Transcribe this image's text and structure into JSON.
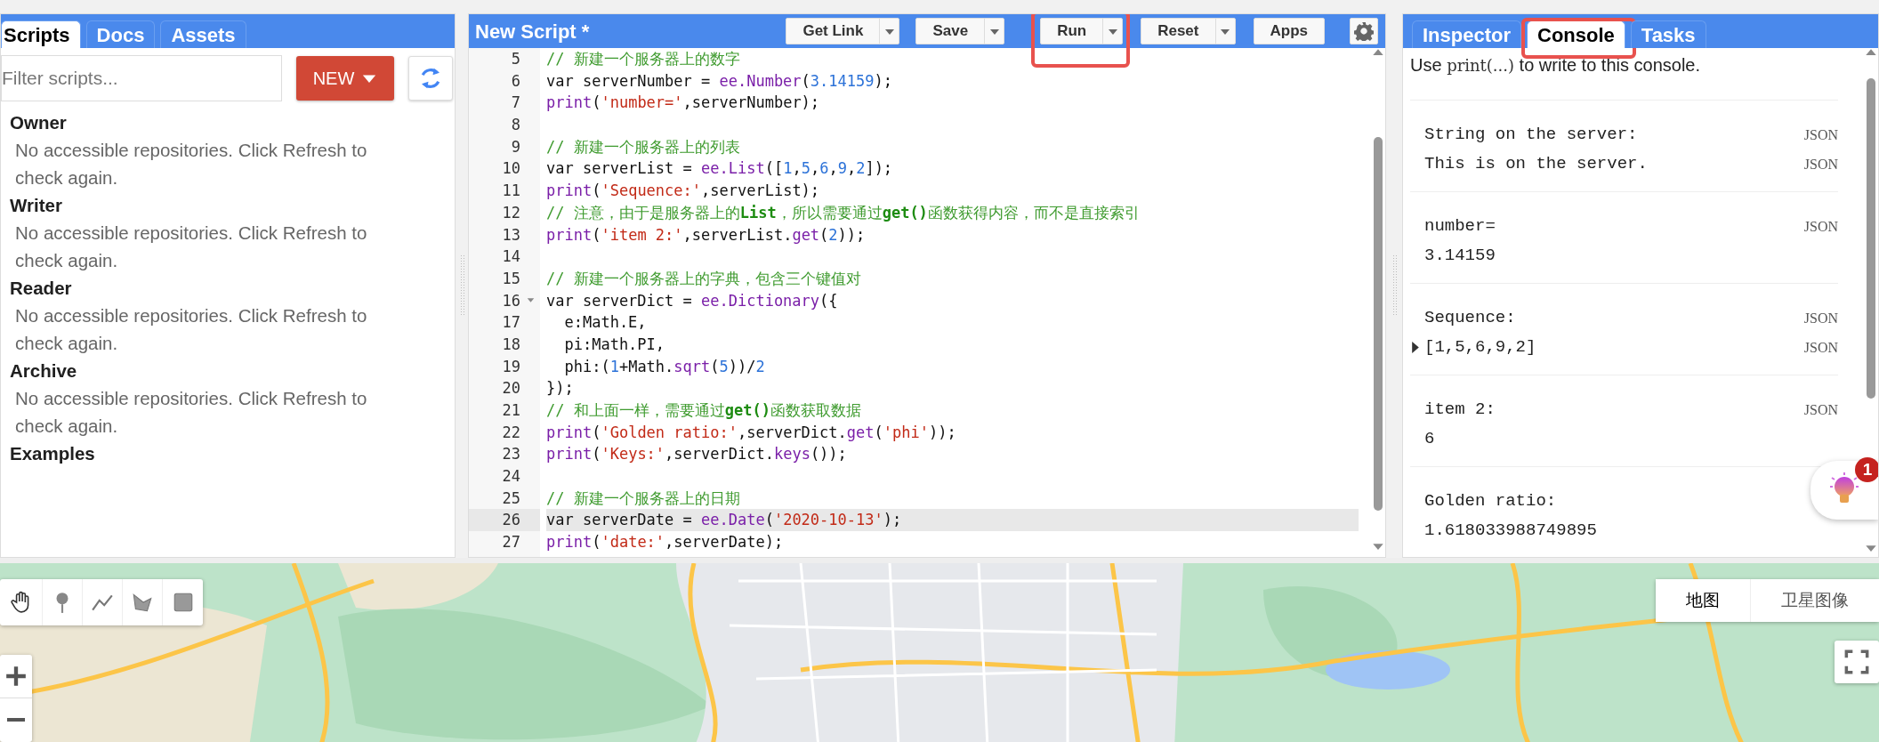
{
  "left_panel": {
    "tabs": [
      {
        "label": "Scripts",
        "selected": true
      },
      {
        "label": "Docs",
        "selected": false
      },
      {
        "label": "Assets",
        "selected": false
      }
    ],
    "filter": {
      "placeholder": "Filter scripts..."
    },
    "new_button": {
      "label": "NEW"
    },
    "sections": [
      {
        "title": "Owner",
        "message": "No accessible repositories. Click Refresh to check again."
      },
      {
        "title": "Writer",
        "message": "No accessible repositories. Click Refresh to check again."
      },
      {
        "title": "Reader",
        "message": "No accessible repositories. Click Refresh to check again."
      },
      {
        "title": "Archive",
        "message": "No accessible repositories. Click Refresh to check again."
      },
      {
        "title": "Examples"
      }
    ]
  },
  "editor": {
    "title": "New Script *",
    "buttons": [
      {
        "label": "Get Link",
        "dropdown": true,
        "highlighted": false
      },
      {
        "label": "Save",
        "dropdown": true,
        "highlighted": false
      },
      {
        "label": "Run",
        "dropdown": true,
        "highlighted": true
      },
      {
        "label": "Reset",
        "dropdown": true,
        "highlighted": false
      },
      {
        "label": "Apps",
        "dropdown": false,
        "highlighted": false
      }
    ],
    "lines": [
      {
        "number": "5",
        "current": false,
        "foldable": false,
        "tokens": [
          {
            "kind": "comment",
            "text": "// 新建一个服务器上的数字"
          }
        ]
      },
      {
        "number": "6",
        "current": false,
        "foldable": false,
        "tokens": [
          {
            "kind": "plain",
            "text": "var serverNumber = "
          },
          {
            "kind": "call",
            "text": "ee.Number"
          },
          {
            "kind": "plain",
            "text": "("
          },
          {
            "kind": "number",
            "text": "3.14159"
          },
          {
            "kind": "plain",
            "text": ");"
          }
        ]
      },
      {
        "number": "7",
        "current": false,
        "foldable": false,
        "tokens": [
          {
            "kind": "call",
            "text": "print"
          },
          {
            "kind": "plain",
            "text": "("
          },
          {
            "kind": "string",
            "text": "'number='"
          },
          {
            "kind": "plain",
            "text": ",serverNumber);"
          }
        ]
      },
      {
        "number": "8",
        "current": false,
        "foldable": false
      },
      {
        "number": "9",
        "current": false,
        "foldable": false,
        "tokens": [
          {
            "kind": "comment",
            "text": "// 新建一个服务器上的列表"
          }
        ]
      },
      {
        "number": "10",
        "current": false,
        "foldable": false,
        "tokens": [
          {
            "kind": "plain",
            "text": "var serverList = "
          },
          {
            "kind": "call",
            "text": "ee.List"
          },
          {
            "kind": "plain",
            "text": "(["
          },
          {
            "kind": "number",
            "text": "1"
          },
          {
            "kind": "plain",
            "text": ","
          },
          {
            "kind": "number",
            "text": "5"
          },
          {
            "kind": "plain",
            "text": ","
          },
          {
            "kind": "number",
            "text": "6"
          },
          {
            "kind": "plain",
            "text": ","
          },
          {
            "kind": "number",
            "text": "9"
          },
          {
            "kind": "plain",
            "text": ","
          },
          {
            "kind": "number",
            "text": "2"
          },
          {
            "kind": "plain",
            "text": "]);"
          }
        ]
      },
      {
        "number": "11",
        "current": false,
        "foldable": false,
        "tokens": [
          {
            "kind": "call",
            "text": "print"
          },
          {
            "kind": "plain",
            "text": "("
          },
          {
            "kind": "string",
            "text": "'Sequence:'"
          },
          {
            "kind": "plain",
            "text": ",serverList);"
          }
        ]
      },
      {
        "number": "12",
        "current": false,
        "foldable": false,
        "tokens": [
          {
            "kind": "comment",
            "text": "// 注意，由于是服务器上的**List**，所以需要通过**get()**函数获得内容，而不是直接索引"
          }
        ]
      },
      {
        "number": "13",
        "current": false,
        "foldable": false,
        "tokens": [
          {
            "kind": "call",
            "text": "print"
          },
          {
            "kind": "plain",
            "text": "("
          },
          {
            "kind": "string",
            "text": "'item 2:'"
          },
          {
            "kind": "plain",
            "text": ",serverList."
          },
          {
            "kind": "call",
            "text": "get"
          },
          {
            "kind": "plain",
            "text": "("
          },
          {
            "kind": "number",
            "text": "2"
          },
          {
            "kind": "plain",
            "text": "));"
          }
        ]
      },
      {
        "number": "14",
        "current": false,
        "foldable": false
      },
      {
        "number": "15",
        "current": false,
        "foldable": false,
        "tokens": [
          {
            "kind": "comment",
            "text": "// 新建一个服务器上的字典，包含三个键值对"
          }
        ]
      },
      {
        "number": "16",
        "current": false,
        "foldable": true,
        "tokens": [
          {
            "kind": "plain",
            "text": "var serverDict = "
          },
          {
            "kind": "call",
            "text": "ee.Dictionary"
          },
          {
            "kind": "plain",
            "text": "({"
          }
        ]
      },
      {
        "number": "17",
        "current": false,
        "foldable": false,
        "tokens": [
          {
            "kind": "plain",
            "text": "  e:Math.E,"
          }
        ]
      },
      {
        "number": "18",
        "current": false,
        "foldable": false,
        "tokens": [
          {
            "kind": "plain",
            "text": "  pi:Math.PI,"
          }
        ]
      },
      {
        "number": "19",
        "current": false,
        "foldable": false,
        "tokens": [
          {
            "kind": "plain",
            "text": "  phi:("
          },
          {
            "kind": "number",
            "text": "1"
          },
          {
            "kind": "plain",
            "text": "+Math."
          },
          {
            "kind": "call",
            "text": "sqrt"
          },
          {
            "kind": "plain",
            "text": "("
          },
          {
            "kind": "number",
            "text": "5"
          },
          {
            "kind": "plain",
            "text": "))/"
          },
          {
            "kind": "number",
            "text": "2"
          }
        ]
      },
      {
        "number": "20",
        "current": false,
        "foldable": false,
        "tokens": [
          {
            "kind": "plain",
            "text": "});"
          }
        ]
      },
      {
        "number": "21",
        "current": false,
        "foldable": false,
        "tokens": [
          {
            "kind": "comment",
            "text": "// 和上面一样，需要通过**get()**函数获取数据"
          }
        ]
      },
      {
        "number": "22",
        "current": false,
        "foldable": false,
        "tokens": [
          {
            "kind": "call",
            "text": "print"
          },
          {
            "kind": "plain",
            "text": "("
          },
          {
            "kind": "string",
            "text": "'Golden ratio:'"
          },
          {
            "kind": "plain",
            "text": ",serverDict."
          },
          {
            "kind": "call",
            "text": "get"
          },
          {
            "kind": "plain",
            "text": "("
          },
          {
            "kind": "string",
            "text": "'phi'"
          },
          {
            "kind": "plain",
            "text": "));"
          }
        ]
      },
      {
        "number": "23",
        "current": false,
        "foldable": false,
        "tokens": [
          {
            "kind": "call",
            "text": "print"
          },
          {
            "kind": "plain",
            "text": "("
          },
          {
            "kind": "string",
            "text": "'Keys:'"
          },
          {
            "kind": "plain",
            "text": ",serverDict."
          },
          {
            "kind": "call",
            "text": "keys"
          },
          {
            "kind": "plain",
            "text": "());"
          }
        ]
      },
      {
        "number": "24",
        "current": false,
        "foldable": false
      },
      {
        "number": "25",
        "current": false,
        "foldable": false,
        "tokens": [
          {
            "kind": "comment",
            "text": "// 新建一个服务器上的日期"
          }
        ]
      },
      {
        "number": "26",
        "current": true,
        "foldable": false,
        "tokens": [
          {
            "kind": "plain",
            "text": "var serverDate = "
          },
          {
            "kind": "call",
            "text": "ee.Date"
          },
          {
            "kind": "plain",
            "text": "("
          },
          {
            "kind": "string",
            "text": "'2020-10-13'"
          },
          {
            "kind": "plain",
            "text": ");"
          }
        ]
      },
      {
        "number": "27",
        "current": false,
        "foldable": false,
        "tokens": [
          {
            "kind": "call",
            "text": "print"
          },
          {
            "kind": "plain",
            "text": "("
          },
          {
            "kind": "string",
            "text": "'date:'"
          },
          {
            "kind": "plain",
            "text": ",serverDate);"
          }
        ]
      }
    ]
  },
  "right_panel": {
    "tabs": [
      {
        "label": "Inspector",
        "selected": false,
        "highlighted": false
      },
      {
        "label": "Console",
        "selected": true,
        "highlighted": true
      },
      {
        "label": "Tasks",
        "selected": false,
        "highlighted": false
      }
    ],
    "intro": [
      {
        "kind": "text",
        "text": "Use "
      },
      {
        "kind": "code",
        "text": "print(...)"
      },
      {
        "kind": "text",
        "text": " to write to this console."
      }
    ],
    "entries": [
      {
        "rows": [
          {
            "text": "String on the server:",
            "format": "JSON",
            "expandable": false
          },
          {
            "text": "This is on the server.",
            "format": "JSON",
            "expandable": false
          }
        ]
      },
      {
        "rows": [
          {
            "text": "number=",
            "format": "JSON",
            "expandable": false
          },
          {
            "text": "3.14159",
            "expandable": false
          }
        ]
      },
      {
        "rows": [
          {
            "text": "Sequence:",
            "format": "JSON",
            "expandable": false
          },
          {
            "text": "[1,5,6,9,2]",
            "format": "JSON",
            "expandable": true
          }
        ]
      },
      {
        "rows": [
          {
            "text": "item 2:",
            "format": "JSON",
            "expandable": false
          },
          {
            "text": "6",
            "expandable": false
          }
        ]
      },
      {
        "rows": [
          {
            "text": "Golden ratio:",
            "expandable": false
          },
          {
            "text": "1.618033988749895",
            "expandable": false
          }
        ]
      }
    ]
  },
  "help_button": {
    "badge": "1"
  },
  "map": {
    "kind": "picture",
    "map_types": [
      {
        "label": "地图",
        "selected": true
      },
      {
        "label": "卫星图像",
        "selected": false
      }
    ]
  }
}
